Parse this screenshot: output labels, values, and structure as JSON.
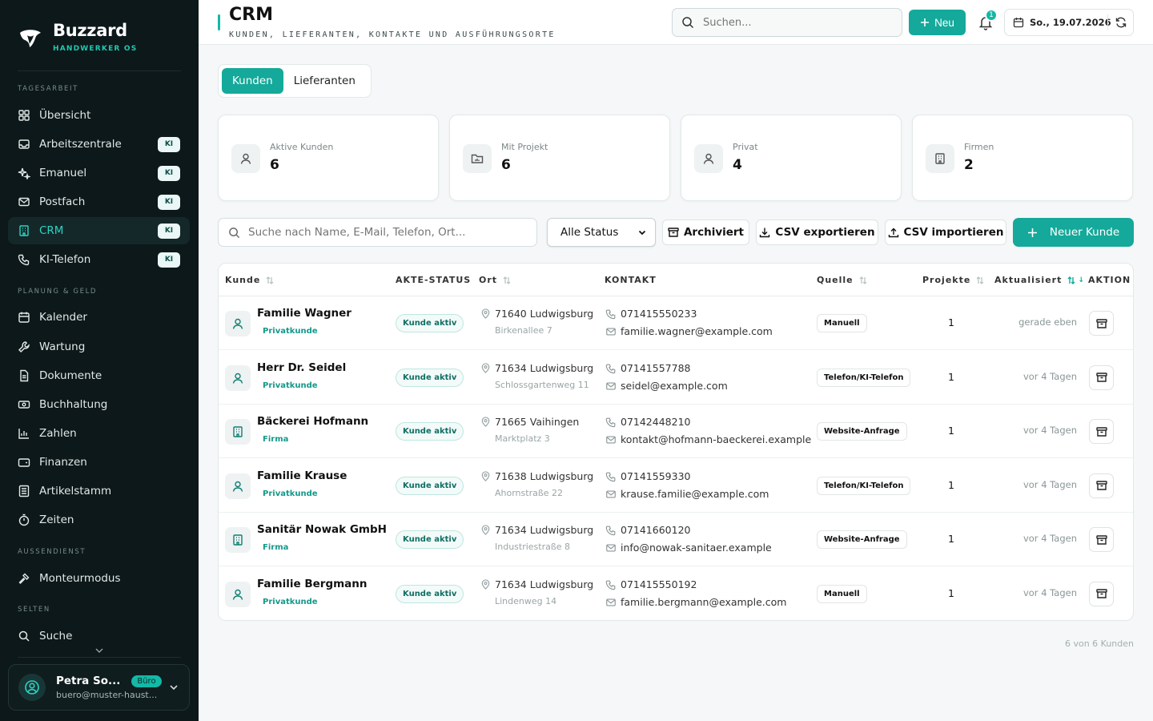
{
  "brand": {
    "name": "Buzzard",
    "subtitle": "HANDWERKER OS"
  },
  "sidebar": {
    "sections": {
      "tagesarbeit": "TAGESARBEIT",
      "planung": "PLANUNG & GELD",
      "aussendienst": "AUSSENDIENST",
      "selten": "SELTEN"
    },
    "items": [
      {
        "label": "Übersicht",
        "icon": "grid-icon"
      },
      {
        "label": "Arbeitszentrale",
        "icon": "inbox-icon",
        "badge": "KI"
      },
      {
        "label": "Emanuel",
        "icon": "sparkles-icon",
        "badge": "KI"
      },
      {
        "label": "Postfach",
        "icon": "mail-icon",
        "badge": "KI"
      },
      {
        "label": "CRM",
        "icon": "building-icon",
        "badge": "KI",
        "active": true
      },
      {
        "label": "KI-Telefon",
        "icon": "phone-icon",
        "badge": "KI"
      },
      {
        "label": "Kalender",
        "icon": "calendar-icon"
      },
      {
        "label": "Wartung",
        "icon": "wrench-icon"
      },
      {
        "label": "Dokumente",
        "icon": "document-icon"
      },
      {
        "label": "Buchhaltung",
        "icon": "banknote-icon"
      },
      {
        "label": "Zahlen",
        "icon": "bar-chart-icon"
      },
      {
        "label": "Finanzen",
        "icon": "wallet-icon"
      },
      {
        "label": "Artikelstamm",
        "icon": "list-icon"
      },
      {
        "label": "Zeiten",
        "icon": "timer-icon"
      },
      {
        "label": "Monteurmodus",
        "icon": "hammer-icon"
      },
      {
        "label": "Suche",
        "icon": "search-icon"
      }
    ]
  },
  "user": {
    "name": "Petra So...",
    "role": "Büro",
    "email": "buero@muster-haust..."
  },
  "header": {
    "title": "CRM",
    "subtitle": "KUNDEN, LIEFERANTEN, KONTAKTE UND AUSFÜHRUNGSORTE",
    "search_placeholder": "Suchen...",
    "new_label": "Neu",
    "notifications": "1",
    "date": "So., 19.07.2026"
  },
  "tabs": [
    {
      "label": "Kunden",
      "active": true
    },
    {
      "label": "Lieferanten",
      "active": false
    }
  ],
  "stats": [
    {
      "label": "Aktive Kunden",
      "value": "6",
      "icon": "user-icon"
    },
    {
      "label": "Mit Projekt",
      "value": "6",
      "icon": "folder-icon"
    },
    {
      "label": "Privat",
      "value": "4",
      "icon": "user-icon"
    },
    {
      "label": "Firmen",
      "value": "2",
      "icon": "building-icon"
    }
  ],
  "filters": {
    "search_placeholder": "Suche nach Name, E-Mail, Telefon, Ort...",
    "status_selected": "Alle Status",
    "archived_label": "Archiviert",
    "export_label": "CSV exportieren",
    "import_label": "CSV importieren",
    "new_customer_label": "Neuer Kunde"
  },
  "table": {
    "headers": {
      "kunde": "Kunde",
      "akte": "AKTE-STATUS",
      "ort": "Ort",
      "kontakt": "KONTAKT",
      "quelle": "Quelle",
      "projekte": "Projekte",
      "aktualisiert": "Aktualisiert",
      "aktion": "AKTION"
    },
    "rows": [
      {
        "name": "Familie Wagner",
        "type": "Privatkunde",
        "kind": "person",
        "status": "Kunde aktiv",
        "city": "71640 Ludwigsburg",
        "street": "Birkenallee 7",
        "phone": "071415550233",
        "email": "familie.wagner@example.com",
        "source": "Manuell",
        "projects": "1",
        "updated": "gerade eben"
      },
      {
        "name": "Herr Dr. Seidel",
        "type": "Privatkunde",
        "kind": "person",
        "status": "Kunde aktiv",
        "city": "71634 Ludwigsburg",
        "street": "Schlossgartenweg 11",
        "phone": "07141557788",
        "email": "seidel@example.com",
        "source": "Telefon/KI-Telefon",
        "projects": "1",
        "updated": "vor 4 Tagen"
      },
      {
        "name": "Bäckerei Hofmann",
        "type": "Firma",
        "kind": "company",
        "status": "Kunde aktiv",
        "city": "71665 Vaihingen",
        "street": "Marktplatz 3",
        "phone": "07142448210",
        "email": "kontakt@hofmann-baeckerei.example",
        "source": "Website-Anfrage",
        "projects": "1",
        "updated": "vor 4 Tagen"
      },
      {
        "name": "Familie Krause",
        "type": "Privatkunde",
        "kind": "person",
        "status": "Kunde aktiv",
        "city": "71638 Ludwigsburg",
        "street": "Ahornstraße 22",
        "phone": "07141559330",
        "email": "krause.familie@example.com",
        "source": "Telefon/KI-Telefon",
        "projects": "1",
        "updated": "vor 4 Tagen"
      },
      {
        "name": "Sanitär Nowak GmbH",
        "type": "Firma",
        "kind": "company",
        "status": "Kunde aktiv",
        "city": "71634 Ludwigsburg",
        "street": "Industriestraße 8",
        "phone": "07141660120",
        "email": "info@nowak-sanitaer.example",
        "source": "Website-Anfrage",
        "projects": "1",
        "updated": "vor 4 Tagen"
      },
      {
        "name": "Familie Bergmann",
        "type": "Privatkunde",
        "kind": "person",
        "status": "Kunde aktiv",
        "city": "71634 Ludwigsburg",
        "street": "Lindenweg 14",
        "phone": "071415550192",
        "email": "familie.bergmann@example.com",
        "source": "Manuell",
        "projects": "1",
        "updated": "vor 4 Tagen"
      }
    ]
  },
  "footer": {
    "count": "6 von 6 Kunden"
  },
  "colors": {
    "accent": "#14a99a",
    "sidebar_bg": "#0c1819",
    "active_text": "#2bd4c0"
  }
}
